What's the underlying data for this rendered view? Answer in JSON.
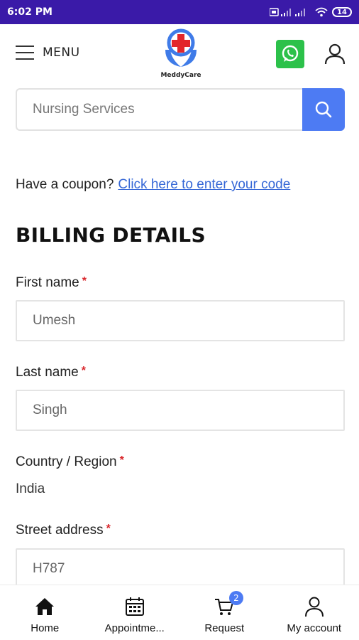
{
  "status_bar": {
    "time": "6:02 PM",
    "battery": "14"
  },
  "header": {
    "menu_label": "MENU",
    "logo_text": "MeddyCare"
  },
  "search": {
    "placeholder": "Nursing Services"
  },
  "coupon": {
    "prompt": "Have a coupon?",
    "link": "Click here to enter your code"
  },
  "billing": {
    "title": "BILLING DETAILS",
    "required_mark": "*",
    "first_name": {
      "label": "First name",
      "value": "Umesh"
    },
    "last_name": {
      "label": "Last name",
      "value": "Singh"
    },
    "country": {
      "label": "Country / Region",
      "value": "India"
    },
    "street": {
      "label": "Street address",
      "value": "H787"
    }
  },
  "bottom_nav": {
    "items": [
      {
        "label": "Home",
        "icon": "home-icon"
      },
      {
        "label": "Appointme...",
        "icon": "appointment-icon"
      },
      {
        "label": "Request",
        "icon": "cart-icon",
        "badge": "2"
      },
      {
        "label": "My account",
        "icon": "user-icon"
      }
    ]
  },
  "colors": {
    "status_bar": "#3a1aa8",
    "accent": "#4d7bf3",
    "link": "#3567d6",
    "whatsapp": "#2cc14a",
    "required": "#d9262b"
  }
}
